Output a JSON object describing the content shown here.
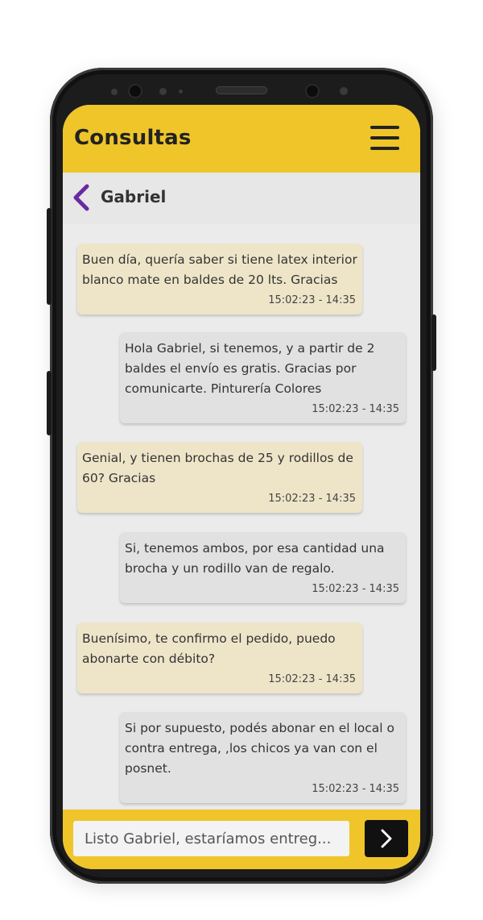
{
  "header": {
    "title": "Consultas"
  },
  "contact": {
    "name": "Gabriel"
  },
  "messages": [
    {
      "direction": "in",
      "text": "Buen día, quería saber si tiene latex interior blanco mate en baldes de 20 lts. Gracias",
      "time": "15:02:23 - 14:35"
    },
    {
      "direction": "out",
      "text": "Hola Gabriel, si tenemos, y a partir de 2 baldes el envío es gratis. Gracias por comunicarte. Pinturería Colores",
      "time": "15:02:23 - 14:35"
    },
    {
      "direction": "in",
      "text": "Genial, y tienen brochas de 25 y rodillos de 60? Gracias",
      "time": "15:02:23 - 14:35"
    },
    {
      "direction": "out",
      "text": "Si, tenemos ambos, por esa cantidad una brocha y un rodillo van de regalo.",
      "time": "15:02:23 - 14:35"
    },
    {
      "direction": "in",
      "text": "Buenísimo, te confirmo el pedido, puedo abonarte con débito?",
      "time": "15:02:23 - 14:35"
    },
    {
      "direction": "out",
      "text": "Si por supuesto, podés abonar en el local o contra entrega, ,los chicos ya van con el posnet.",
      "time": "15:02:23 - 14:35"
    }
  ],
  "composer": {
    "value": "Listo Gabriel, estaríamos entreg..."
  },
  "icons": {
    "menu": "hamburger-menu-icon",
    "back": "chevron-left-icon",
    "send": "chevron-right-icon"
  },
  "colors": {
    "brand_yellow": "#efc52a",
    "back_arrow": "#6a2aa0",
    "incoming_bubble": "#eee5c9",
    "outgoing_bubble": "#e1e1e1",
    "send_button": "#111111"
  }
}
